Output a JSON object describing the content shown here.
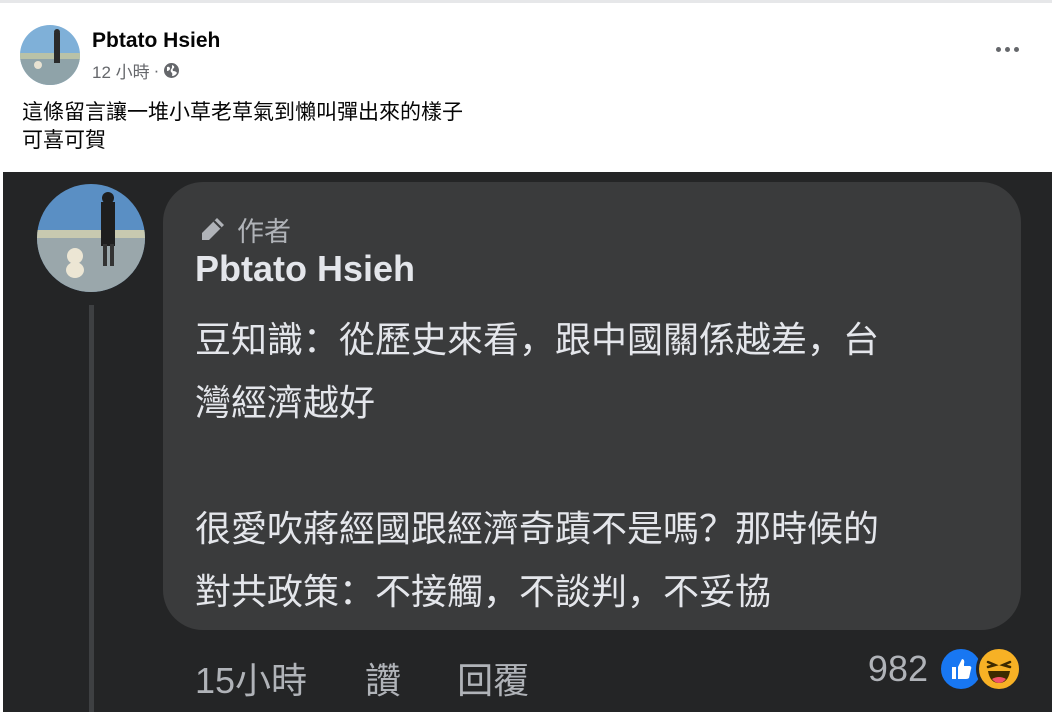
{
  "post": {
    "author": "Pbtato Hsieh",
    "time": "12 小時",
    "separator": "·",
    "privacy_icon": "globe-icon",
    "more_icon": "more-horizontal-icon",
    "text_line1": "這條留言讓一堆小草老草氣到懶叫彈出來的樣子",
    "text_line2": "可喜可賀"
  },
  "comment": {
    "badge_icon": "pen-icon",
    "badge_label": "作者",
    "author": "Pbtato Hsieh",
    "body_line1": "豆知識：從歷史來看，跟中國關係越差，台",
    "body_line2": "灣經濟越好",
    "body_line3": "很愛吹蔣經國跟經濟奇蹟不是嗎？那時候的",
    "body_line4": "對共政策：不接觸，不談判，不妥協",
    "time": "15小時",
    "like_label": "讚",
    "reply_label": "回覆",
    "reaction_count": "982",
    "reaction_icons": [
      "like-icon",
      "haha-icon"
    ]
  },
  "colors": {
    "dark_background": "#242526",
    "bubble": "#3a3b3c",
    "like_blue": "#1877f2",
    "haha_yellow": "#f7b125"
  }
}
